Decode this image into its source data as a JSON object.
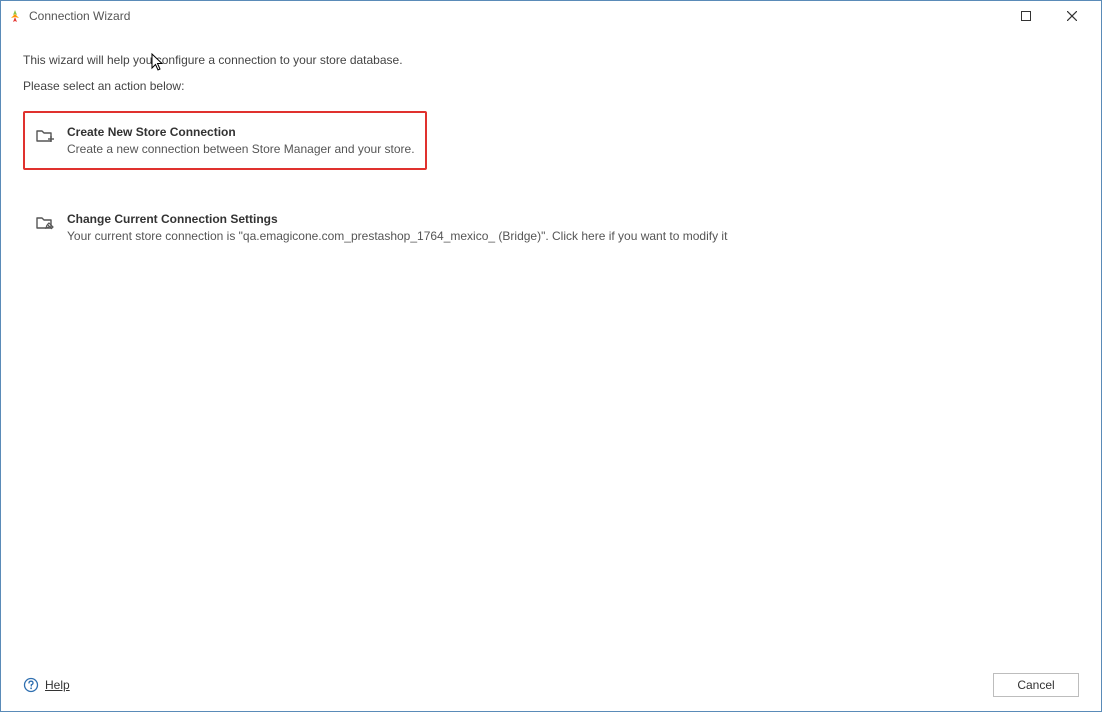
{
  "window": {
    "title": "Connection Wizard"
  },
  "intro": {
    "line1": "This wizard will help you configure a connection to your store database.",
    "line2": "Please select an action below:"
  },
  "options": [
    {
      "icon_name": "folder-plus-icon",
      "title": "Create New Store Connection",
      "description": "Create a new connection between Store Manager and your store.",
      "highlighted": true
    },
    {
      "icon_name": "folder-edit-icon",
      "title": "Change Current Connection Settings",
      "description": "Your current store connection is \"qa.emagicone.com_prestashop_1764_mexico_ (Bridge)\". Click here if you want to modify it",
      "highlighted": false
    }
  ],
  "footer": {
    "help_label": "Help",
    "cancel_label": "Cancel"
  }
}
